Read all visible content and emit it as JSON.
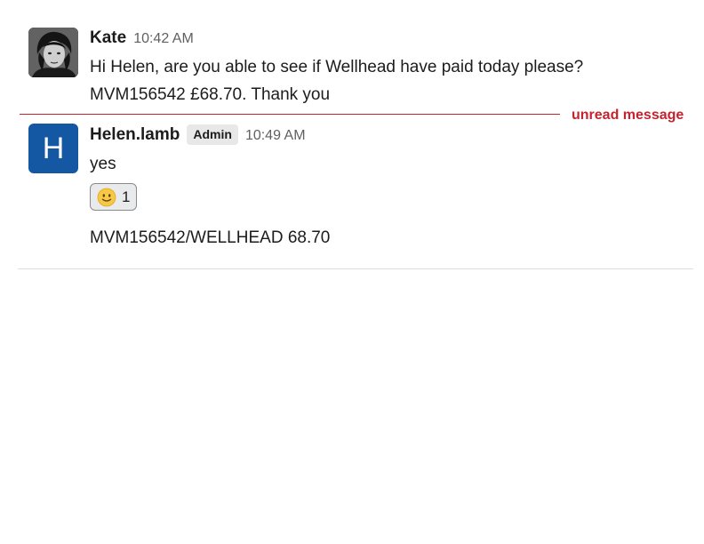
{
  "messages": [
    {
      "author": "Kate",
      "timestamp": "10:42 AM",
      "lines": [
        "Hi Helen, are you able to see if Wellhead have paid today please?",
        "MVM156542 £68.70. Thank you"
      ],
      "avatar_icon": "person-photo"
    },
    {
      "author": "Helen.lamb",
      "badge": "Admin",
      "timestamp": "10:49 AM",
      "avatar_letter": "H",
      "text": "yes",
      "reaction": {
        "emoji_icon": "slightly-smiling-face-icon",
        "count": "1"
      },
      "followup": "MVM156542/WELLHEAD 68.70"
    }
  ],
  "unread_divider": {
    "label": "unread message"
  },
  "colors": {
    "unread": "#c4232f",
    "avatar_h": "#1457a3",
    "badge_bg": "#e8e8e8"
  }
}
